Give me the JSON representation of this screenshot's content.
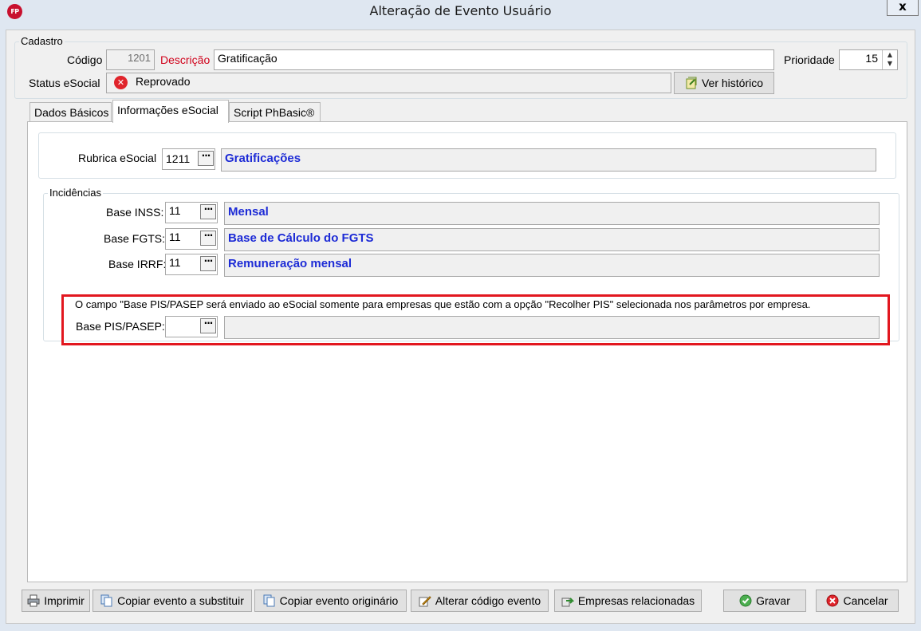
{
  "window": {
    "title": "Alteração de Evento Usuário",
    "app_icon_text": "FP",
    "close_label": "x"
  },
  "cadastro": {
    "legend": "Cadastro",
    "codigo_label": "Código",
    "codigo_value": "1201",
    "descricao_label": "Descrição",
    "descricao_value": "Gratificação",
    "prioridade_label": "Prioridade",
    "prioridade_value": "15",
    "status_label": "Status eSocial",
    "status_value": "Reprovado",
    "ver_historico_label": "Ver histórico"
  },
  "tabs": [
    {
      "label": "Dados Básicos"
    },
    {
      "label": "Informações eSocial"
    },
    {
      "label": "Script PhBasic®"
    }
  ],
  "rubrica": {
    "label": "Rubrica eSocial",
    "code": "1211",
    "description": "Gratificações"
  },
  "incidencias": {
    "legend": "Incidências",
    "rows": [
      {
        "label": "Base INSS:",
        "code": "11",
        "description": "Mensal"
      },
      {
        "label": "Base FGTS:",
        "code": "11",
        "description": "Base de Cálculo do FGTS"
      },
      {
        "label": "Base IRRF:",
        "code": "11",
        "description": "Remuneração mensal"
      }
    ],
    "note": "O campo \"Base PIS/PASEP será enviado ao eSocial somente para empresas que estão com a opção \"Recolher PIS\" selecionada nos parâmetros por empresa.",
    "pis_label": "Base PIS/PASEP:",
    "pis_code": "",
    "pis_description": ""
  },
  "dots_label": "···",
  "buttons": {
    "imprimir": "Imprimir",
    "copiar_substituir": "Copiar evento a substituir",
    "copiar_originario": "Copiar evento originário",
    "alterar_codigo": "Alterar código evento",
    "empresas_relacionadas": "Empresas relacionadas",
    "gravar": "Gravar",
    "cancelar": "Cancelar"
  },
  "colors": {
    "accent_red": "#e2171f",
    "link_blue": "#1d2bd6",
    "descricao_red": "#d0021b"
  }
}
